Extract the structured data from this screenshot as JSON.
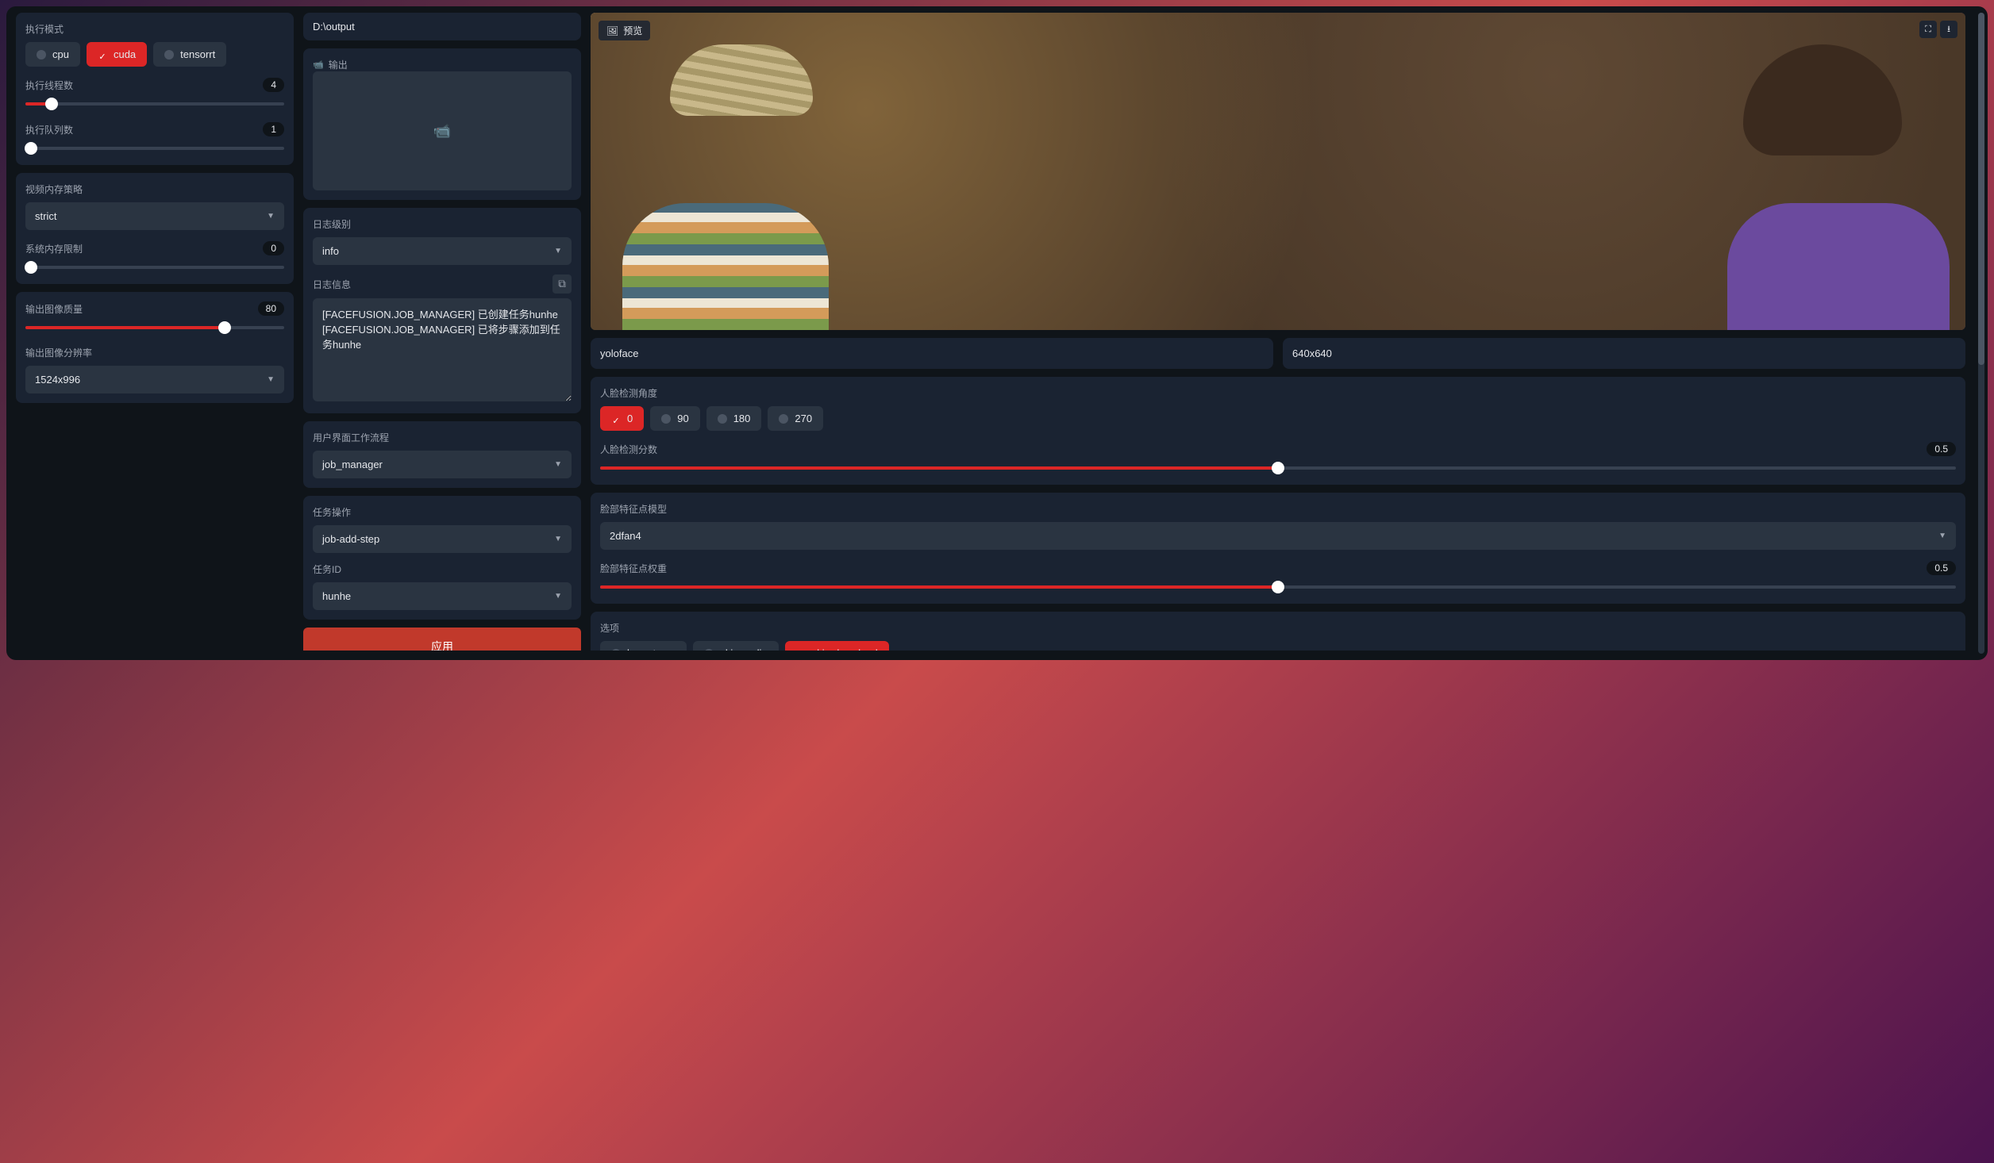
{
  "left": {
    "exec_mode_label": "执行模式",
    "exec_providers": [
      "cpu",
      "cuda",
      "tensorrt"
    ],
    "exec_provider_selected": "cuda",
    "thread_label": "执行线程数",
    "thread_value": "4",
    "thread_percent": 10,
    "queue_label": "执行队列数",
    "queue_value": "1",
    "queue_percent": 2,
    "vram_label": "视频内存策略",
    "vram_value": "strict",
    "sysmem_label": "系统内存限制",
    "sysmem_value": "0",
    "sysmem_percent": 2,
    "quality_label": "输出图像质量",
    "quality_value": "80",
    "quality_percent": 77,
    "resolution_label": "输出图像分辨率",
    "resolution_value": "1524x996"
  },
  "middle": {
    "output_path": "D:\\output",
    "output_label": "输出",
    "loglevel_label": "日志级别",
    "loglevel_value": "info",
    "loginfo_label": "日志信息",
    "loginfo_text": "[FACEFUSION.JOB_MANAGER] 已创建任务hunhe\n[FACEFUSION.JOB_MANAGER] 已将步骤添加到任务hunhe",
    "workflow_label": "用户界面工作流程",
    "workflow_value": "job_manager",
    "jobaction_label": "任务操作",
    "jobaction_value": "job-add-step",
    "jobid_label": "任务ID",
    "jobid_value": "hunhe",
    "apply_label": "应用"
  },
  "right": {
    "preview_label": "预览",
    "detector_model_value": "yoloface",
    "detector_size_value": "640x640",
    "angle_label": "人脸检测角度",
    "angle_options": [
      "0",
      "90",
      "180",
      "270"
    ],
    "angle_selected": "0",
    "score_label": "人脸检测分数",
    "score_value": "0.5",
    "score_percent": 50,
    "landmark_label": "脸部特征点模型",
    "landmark_value": "2dfan4",
    "landmark_weight_label": "脸部特征点权重",
    "landmark_weight_value": "0.5",
    "landmark_weight_percent": 50,
    "options_label": "选项",
    "option_items": [
      "keep-temp",
      "skip-audio",
      "skip-download"
    ],
    "option_selected": "skip-download"
  }
}
